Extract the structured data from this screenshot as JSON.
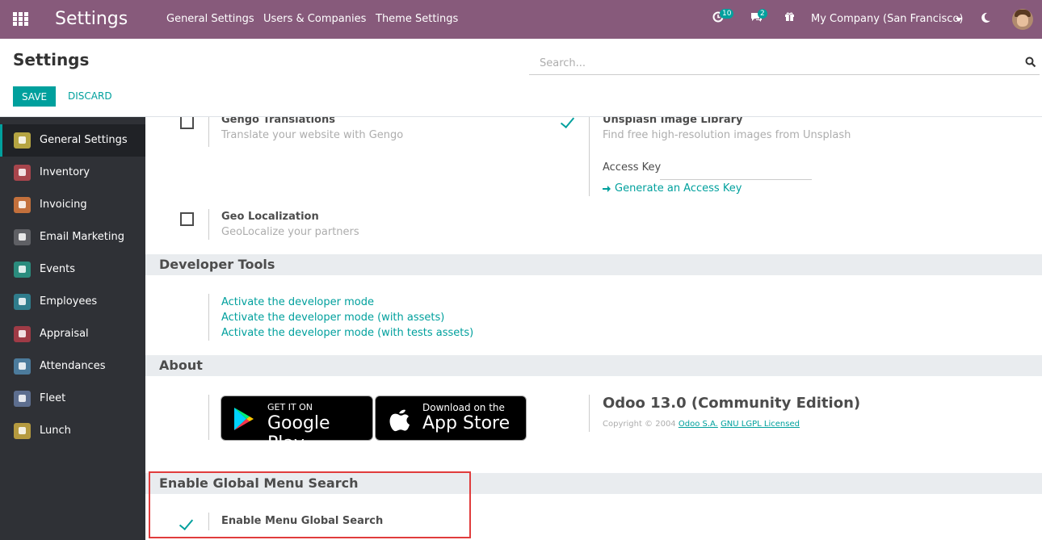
{
  "navbar": {
    "brand": "Settings",
    "menu": [
      "General Settings",
      "Users & Companies",
      "Theme Settings"
    ],
    "activities_count": "10",
    "messages_count": "2",
    "company": "My Company (San Francisco)"
  },
  "control": {
    "title": "Settings",
    "search_placeholder": "Search...",
    "save_label": "SAVE",
    "discard_label": "DISCARD"
  },
  "sidebar": {
    "items": [
      {
        "label": "General Settings",
        "color": "#b5a442"
      },
      {
        "label": "Inventory",
        "color": "#a7454c"
      },
      {
        "label": "Invoicing",
        "color": "#c3703c"
      },
      {
        "label": "Email Marketing",
        "color": "#5f6065"
      },
      {
        "label": "Events",
        "color": "#2b8c7e"
      },
      {
        "label": "Employees",
        "color": "#2f7c8c"
      },
      {
        "label": "Appraisal",
        "color": "#9f3b46"
      },
      {
        "label": "Attendances",
        "color": "#4c7b9c"
      },
      {
        "label": "Fleet",
        "color": "#5d6e8f"
      },
      {
        "label": "Lunch",
        "color": "#b59a3f"
      }
    ]
  },
  "integrations": {
    "gengo_title": "Gengo Translations",
    "gengo_desc": "Translate your website with Gengo",
    "unsplash_title": "Unsplash Image Library",
    "unsplash_desc": "Find free high-resolution images from Unsplash",
    "access_key_label": "Access Key",
    "generate_link": "Generate an Access Key",
    "geo_title": "Geo Localization",
    "geo_desc": "GeoLocalize your partners"
  },
  "developer": {
    "heading": "Developer Tools",
    "links": [
      "Activate the developer mode",
      "Activate the developer mode (with assets)",
      "Activate the developer mode (with tests assets)"
    ]
  },
  "about": {
    "heading": "About",
    "google_small": "GET IT ON",
    "google_big": "Google Play",
    "apple_small": "Download on the",
    "apple_big": "App Store",
    "edition": "Odoo 13.0 (Community Edition)",
    "copyright_prefix": "Copyright © 2004",
    "company_link": "Odoo S.A.",
    "license_link": "GNU LGPL Licensed"
  },
  "global_search": {
    "heading": "Enable Global Menu Search",
    "option_title": "Enable Menu Global Search"
  }
}
